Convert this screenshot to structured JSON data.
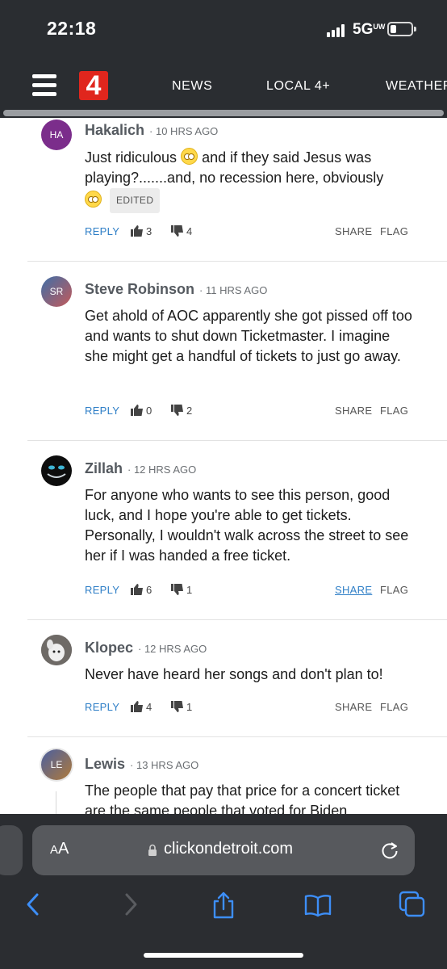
{
  "status_bar": {
    "time": "22:18",
    "network": "5G",
    "network_sub": "UW"
  },
  "site": {
    "logo": "4",
    "nav": [
      "NEWS",
      "LOCAL 4+",
      "WEATHER"
    ]
  },
  "comments": [
    {
      "initials": "HA",
      "avatar_color": "#7b2d8b",
      "username": "Hakalich",
      "age": "· 10 HRS AGO",
      "body_parts": [
        "Just ridiculous",
        "and if they said Jesus was playing?.......and, no recession here, obviously"
      ],
      "edited": "EDITED",
      "reply": "REPLY",
      "upvotes": "3",
      "downvotes": "4",
      "share": "SHARE",
      "flag": "FLAG"
    },
    {
      "initials": "SR",
      "avatar_color": "#5a7fa8",
      "username": "Steve Robinson",
      "age": "· 11 HRS AGO",
      "body": "Get ahold of AOC apparently she got pissed off too and wants to shut down Ticketmaster. I imagine she might get a handful of tickets to just go away.",
      "reply": "REPLY",
      "upvotes": "0",
      "downvotes": "2",
      "share": "SHARE",
      "flag": "FLAG"
    },
    {
      "initials": "",
      "avatar_color": "#0d0d0d",
      "username": "Zillah",
      "age": "· 12 HRS AGO",
      "body": "For anyone who wants to see this person, good luck, and I hope you're able to get tickets. Personally, I wouldn't walk across the street to see her if I was handed a free ticket.",
      "reply": "REPLY",
      "upvotes": "6",
      "downvotes": "1",
      "share": "SHARE",
      "flag": "FLAG"
    },
    {
      "initials": "",
      "avatar_color": "#8a8580",
      "username": "Klopec",
      "age": "· 12 HRS AGO",
      "body": "Never have heard her songs and don't plan to!",
      "reply": "REPLY",
      "upvotes": "4",
      "downvotes": "1",
      "share": "SHARE",
      "flag": "FLAG"
    },
    {
      "initials": "LE",
      "avatar_color": "#6b5a8e",
      "username": "Lewis",
      "age": "· 13 HRS AGO",
      "body": "The people that pay that price for a concert ticket are the same people that voted for Biden"
    }
  ],
  "browser": {
    "text_size": "AA",
    "url": "clickondetroit.com"
  }
}
